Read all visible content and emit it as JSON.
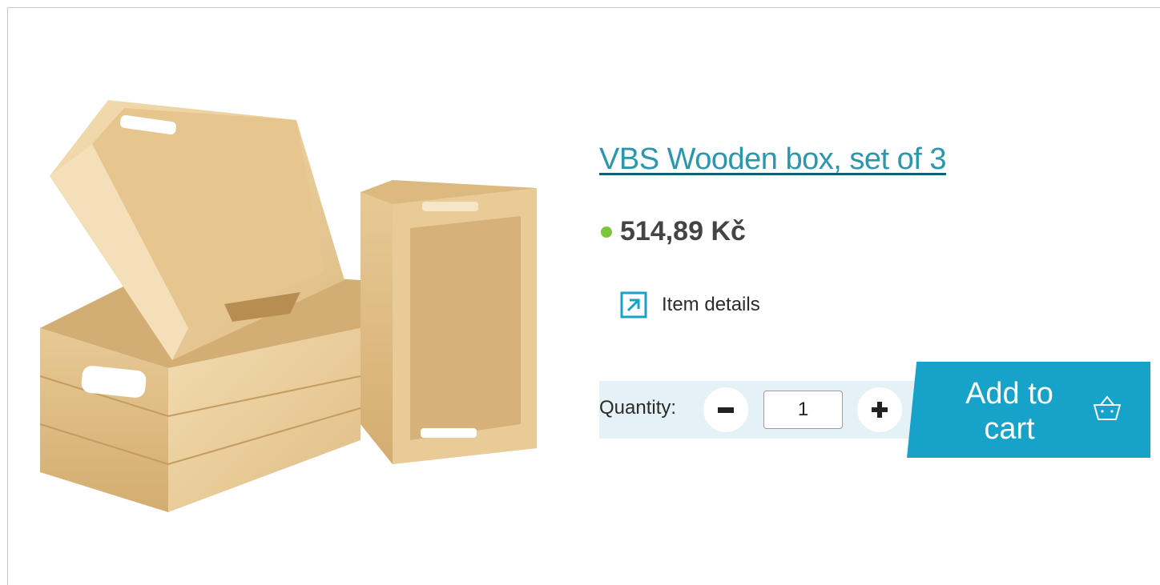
{
  "product": {
    "title": "VBS Wooden box, set of 3",
    "price": "514,89 Kč",
    "stock_status_color": "#7dc63c",
    "details_label": "Item details",
    "details_icon": "external-link-arrow-icon",
    "image_alt": "Three wooden crates"
  },
  "purchase": {
    "quantity_label": "Quantity:",
    "quantity_value": "1",
    "decrease_icon": "minus-icon",
    "increase_icon": "plus-icon",
    "add_to_cart_label": "Add to\ncart",
    "cart_icon": "basket-icon"
  },
  "colors": {
    "accent": "#17a3c9",
    "link": "#2b97ad",
    "link_underline": "#0f5f76",
    "quantity_panel": "#e4f1f7",
    "price_text": "#444444"
  }
}
